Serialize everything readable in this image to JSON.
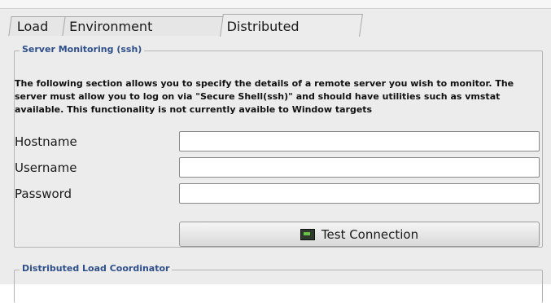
{
  "tabs": [
    {
      "label": "Load"
    },
    {
      "label": "Environment Variables"
    },
    {
      "label": "Distributed Controls"
    }
  ],
  "server_monitoring": {
    "title": "Server Monitoring (ssh)",
    "description": "The following section allows you to specify the details of a remote server you wish to monitor. The server must allow you to log on via \"Secure Shell(ssh)\" and should have utilities such as vmstat available. This functionality is not currently avaible to Window targets",
    "hostname_label": "Hostname",
    "username_label": "Username",
    "password_label": "Password",
    "hostname_value": "",
    "username_value": "",
    "password_value": "",
    "test_button_label": "Test Connection",
    "test_button_icon": "terminal-icon"
  },
  "distributed_load": {
    "title": "Distributed Load Coordinator"
  },
  "colors": {
    "group_title": "#2e4f8a",
    "background": "#ececec"
  }
}
